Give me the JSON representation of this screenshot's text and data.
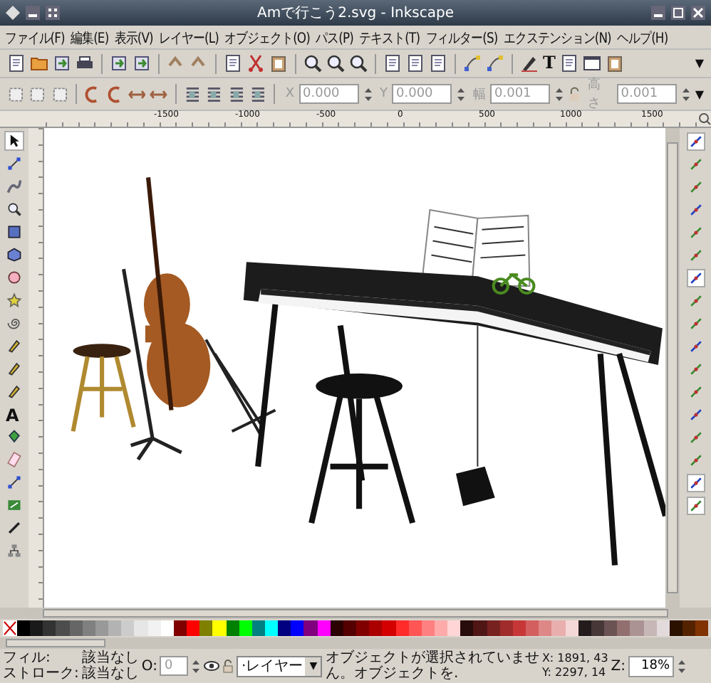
{
  "window": {
    "title": "Amで行こう2.svg - Inkscape"
  },
  "menu": [
    "ファイル(F)",
    "編集(E)",
    "表示(V)",
    "レイヤー(L)",
    "オブジェクト(O)",
    "パス(P)",
    "テキスト(T)",
    "フィルター(S)",
    "エクステンション(N)",
    "ヘルプ(H)"
  ],
  "toolbar": {
    "groups": [
      {
        "buttons": [
          {
            "kind": "doc"
          },
          {
            "kind": "folder"
          },
          {
            "kind": "import"
          },
          {
            "kind": "printer"
          }
        ]
      },
      {
        "buttons": [
          {
            "kind": "import"
          },
          {
            "kind": "export"
          }
        ]
      },
      {
        "buttons": [
          {
            "kind": "undo"
          },
          {
            "kind": "redo"
          }
        ]
      },
      {
        "buttons": [
          {
            "kind": "doc"
          },
          {
            "kind": "scissors"
          },
          {
            "kind": "clipboard"
          }
        ]
      },
      {
        "buttons": [
          {
            "kind": "zoom"
          },
          {
            "kind": "zoom"
          },
          {
            "kind": "zoom"
          }
        ]
      },
      {
        "buttons": [
          {
            "kind": "page"
          },
          {
            "kind": "page"
          },
          {
            "kind": "page"
          }
        ]
      },
      {
        "buttons": [
          {
            "kind": "node"
          },
          {
            "kind": "node"
          }
        ]
      },
      {
        "buttons": [
          {
            "kind": "pen"
          },
          {
            "kind": "glyph",
            "glyph": "T"
          },
          {
            "kind": "page"
          },
          {
            "kind": "window"
          },
          {
            "kind": "clipboard"
          }
        ]
      }
    ],
    "overflow": "▼"
  },
  "controls": {
    "groups": [
      {
        "buttons": [
          {
            "kind": "frame"
          },
          {
            "kind": "frame"
          },
          {
            "kind": "frame"
          }
        ]
      },
      {
        "buttons": [
          {
            "kind": "rotate"
          },
          {
            "kind": "rotate"
          },
          {
            "kind": "flip"
          },
          {
            "kind": "flip"
          }
        ]
      },
      {
        "buttons": [
          {
            "kind": "stack"
          },
          {
            "kind": "stack"
          },
          {
            "kind": "stack"
          },
          {
            "kind": "stack"
          }
        ]
      }
    ],
    "fields": [
      {
        "label": "X",
        "value": "0.000"
      },
      {
        "label": "Y",
        "value": "0.000"
      },
      {
        "label": "幅",
        "value": "0.001"
      },
      {
        "label": "高さ",
        "value": "0.001"
      }
    ],
    "overflow": "▼"
  },
  "ruler": {
    "labels": [
      "-1500",
      "-1000",
      "-500",
      "0",
      "500",
      "1000",
      "1500"
    ]
  },
  "tools": [
    {
      "kind": "arrow",
      "selected": true
    },
    {
      "kind": "node",
      "selected": false
    },
    {
      "kind": "tweak",
      "selected": false
    },
    {
      "kind": "zoom",
      "selected": false
    },
    {
      "kind": "rect",
      "selected": false
    },
    {
      "kind": "box",
      "selected": false
    },
    {
      "kind": "circle",
      "selected": false
    },
    {
      "kind": "star",
      "selected": false
    },
    {
      "kind": "spiral",
      "selected": false
    },
    {
      "kind": "pen",
      "selected": false
    },
    {
      "kind": "pen",
      "selected": false
    },
    {
      "kind": "pen",
      "selected": false
    },
    {
      "kind": "glyph",
      "glyph": "A",
      "selected": false
    },
    {
      "kind": "bucket",
      "selected": false
    },
    {
      "kind": "eraser",
      "selected": false
    },
    {
      "kind": "node",
      "selected": false
    },
    {
      "kind": "line",
      "selected": false
    },
    {
      "kind": "dropper",
      "selected": false
    },
    {
      "kind": "connector",
      "selected": false
    }
  ],
  "snaps": [
    {
      "on": true
    },
    {
      "on": false
    },
    {
      "on": false
    },
    {
      "on": false
    },
    {
      "on": false
    },
    {
      "on": false
    },
    {
      "on": true
    },
    {
      "on": false
    },
    {
      "on": false
    },
    {
      "on": false
    },
    {
      "on": false
    },
    {
      "on": false
    },
    {
      "on": false
    },
    {
      "on": false
    },
    {
      "on": false
    },
    {
      "on": true
    },
    {
      "on": true
    }
  ],
  "palette": [
    {
      "color": "#000000"
    },
    {
      "color": "#1a1a1a"
    },
    {
      "color": "#333333"
    },
    {
      "color": "#4d4d4d"
    },
    {
      "color": "#666666"
    },
    {
      "color": "#808080"
    },
    {
      "color": "#999999"
    },
    {
      "color": "#b3b3b3"
    },
    {
      "color": "#cccccc"
    },
    {
      "color": "#e6e6e6"
    },
    {
      "color": "#f2f2f2"
    },
    {
      "color": "#ffffff"
    },
    {
      "color": "#800000"
    },
    {
      "color": "#ff0000"
    },
    {
      "color": "#808000"
    },
    {
      "color": "#ffff00"
    },
    {
      "color": "#008000"
    },
    {
      "color": "#00ff00"
    },
    {
      "color": "#008080"
    },
    {
      "color": "#00ffff"
    },
    {
      "color": "#000080"
    },
    {
      "color": "#0000ff"
    },
    {
      "color": "#800080"
    },
    {
      "color": "#ff00ff"
    },
    {
      "color": "#2b0000"
    },
    {
      "color": "#550000"
    },
    {
      "color": "#800000"
    },
    {
      "color": "#aa0000"
    },
    {
      "color": "#d40000"
    },
    {
      "color": "#ff2a2a"
    },
    {
      "color": "#ff5555"
    },
    {
      "color": "#ff8080"
    },
    {
      "color": "#ffaaaa"
    },
    {
      "color": "#ffd5d5"
    },
    {
      "color": "#280b0b"
    },
    {
      "color": "#501616"
    },
    {
      "color": "#782121"
    },
    {
      "color": "#a02c2c"
    },
    {
      "color": "#c83737"
    },
    {
      "color": "#d35f5f"
    },
    {
      "color": "#de8787"
    },
    {
      "color": "#e9afaf"
    },
    {
      "color": "#f4d7d7"
    },
    {
      "color": "#241c1c"
    },
    {
      "color": "#483737"
    },
    {
      "color": "#6c5353"
    },
    {
      "color": "#916f6f"
    },
    {
      "color": "#ac9393"
    },
    {
      "color": "#c8b7b7"
    },
    {
      "color": "#e3dbdb"
    },
    {
      "color": "#2b1100"
    },
    {
      "color": "#552200"
    },
    {
      "color": "#803300"
    }
  ],
  "status": {
    "fill_label": "フィル:",
    "fill_value": "該当なし",
    "stroke_label": "ストローク:",
    "stroke_value": "該当なし",
    "opacity_label": "O:",
    "opacity_value": "0",
    "layer": "·レイヤー",
    "layer_button": "▼",
    "message": "オブジェクトが選択されていません。オブジェクトを.",
    "cursor_x": "X: 1891, 43",
    "cursor_y": "Y: 2297, 14",
    "zoom_label": "Z:",
    "zoom_value": "18%"
  }
}
